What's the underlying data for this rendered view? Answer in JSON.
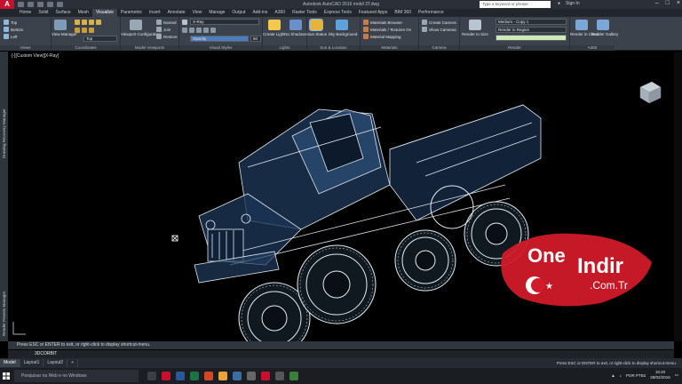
{
  "window": {
    "title": "Autodesk AutoCAD 2016   mobil 3T.dwg",
    "search_placeholder": "Type a keyword or phrase",
    "user": "Sign In"
  },
  "ribbon_tabs": [
    "Home",
    "Solid",
    "Surface",
    "Mesh",
    "Visualize",
    "Parametric",
    "Insert",
    "Annotate",
    "View",
    "Manage",
    "Output",
    "Add-ins",
    "A360",
    "Raster Tools",
    "Express Tools",
    "Featured Apps",
    "BIM 360",
    "Performance"
  ],
  "ribbon_active_tab": "Visualize",
  "panels": {
    "views": {
      "title": "Views",
      "items": [
        "Top",
        "Bottom",
        "Left"
      ]
    },
    "coordinates": {
      "title": "Coordinates",
      "view_manager": "View Manager",
      "ucs_dropdown": "Top"
    },
    "model_viewports": {
      "title": "Model Viewports",
      "config": "Viewport Configuration",
      "named": "Named",
      "join": "Join",
      "restore": "Restore"
    },
    "visual_styles": {
      "title": "Visual Styles",
      "style": "X-Ray",
      "opacity_label": "Opacity",
      "opacity_value": "50"
    },
    "lights": {
      "title": "Lights",
      "create_light": "Create Light",
      "no_shadows": "No Shadows"
    },
    "sun_location": {
      "title": "Sun & Location",
      "sun_status": "Sun Status",
      "sky_background": "Sky Background"
    },
    "materials": {
      "title": "Materials",
      "browser": "Materials Browser",
      "materials_textures": "Materials / Textures On",
      "mapping": "Material Mapping"
    },
    "camera": {
      "title": "Camera",
      "create": "Create Camera",
      "show": "Show Cameras"
    },
    "render": {
      "title": "Render",
      "render_to_size": "Render to Size",
      "preset": "Medium - Copy 1",
      "region": "Render in Region"
    },
    "a360": {
      "title": "A360",
      "cloud": "Render in Cloud",
      "gallery": "Render Gallery"
    }
  },
  "viewport": {
    "label": "[-][Custom View][X-Ray]"
  },
  "side_panels": {
    "left_top": "Drawing Recovery Manager",
    "left_bottom": "Render Presets Manager"
  },
  "command": {
    "history": "Press ESC or ENTER to exit, or right-click to display shortcut-menu.",
    "current": "3DCORBIT"
  },
  "layout_tabs": [
    "Model",
    "Layout1",
    "Layout2",
    "+"
  ],
  "status_message": "Press ESC or ENTER to exit, or right-click to display shortcut-menu.",
  "taskbar": {
    "search": "Pesquisar na Web e no Windows",
    "lang": "POR PTB2",
    "time": "15:20",
    "date": "28/02/2016"
  },
  "watermark": {
    "line1": "One",
    "line2": "Indir",
    "line3": ".Com.Tr"
  },
  "colors": {
    "accent": "#c8102e",
    "ribbon": "#3b424b",
    "model_body": "#1f3a5c",
    "wire": "#dfe7ef"
  }
}
